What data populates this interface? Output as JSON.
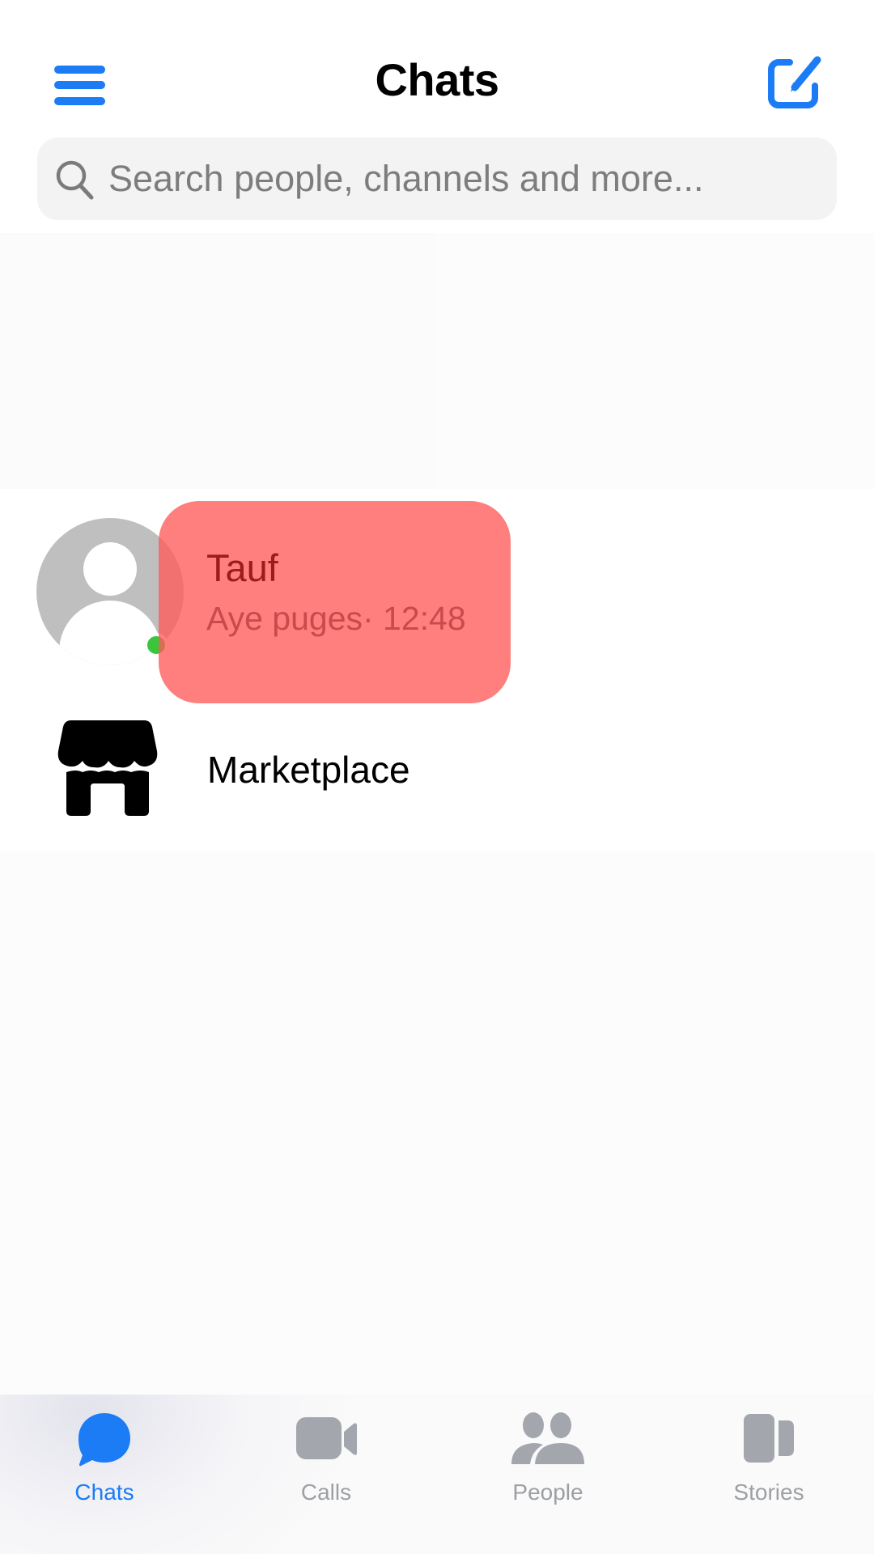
{
  "header": {
    "title": "Chats",
    "menu_icon": "hamburger-menu-icon",
    "compose_icon": "compose-edit-icon"
  },
  "search": {
    "placeholder": "Search people, channels and more...",
    "value": "",
    "icon": "search-icon"
  },
  "chats": [
    {
      "name": "Tauf",
      "last_message": "Aye puges",
      "separator": "·",
      "time": "12:48",
      "subtitle": "Aye puges· 12:48",
      "avatar": "default-person-avatar",
      "online": true
    }
  ],
  "marketplace": {
    "label": "Marketplace",
    "icon": "storefront-icon"
  },
  "tabbar": {
    "active": "Chats",
    "tabs": [
      {
        "label": "Chats",
        "icon": "chat-bubble-icon"
      },
      {
        "label": "Calls",
        "icon": "video-camera-icon"
      },
      {
        "label": "People",
        "icon": "people-icon"
      },
      {
        "label": "Stories",
        "icon": "stories-icon"
      }
    ]
  },
  "colors": {
    "accent": "#1b7cf5",
    "inactive_tab": "#9c9fa5",
    "highlight": "#ff7b7b",
    "online": "#3ac63a",
    "avatar_bg": "#bfbfbf"
  }
}
